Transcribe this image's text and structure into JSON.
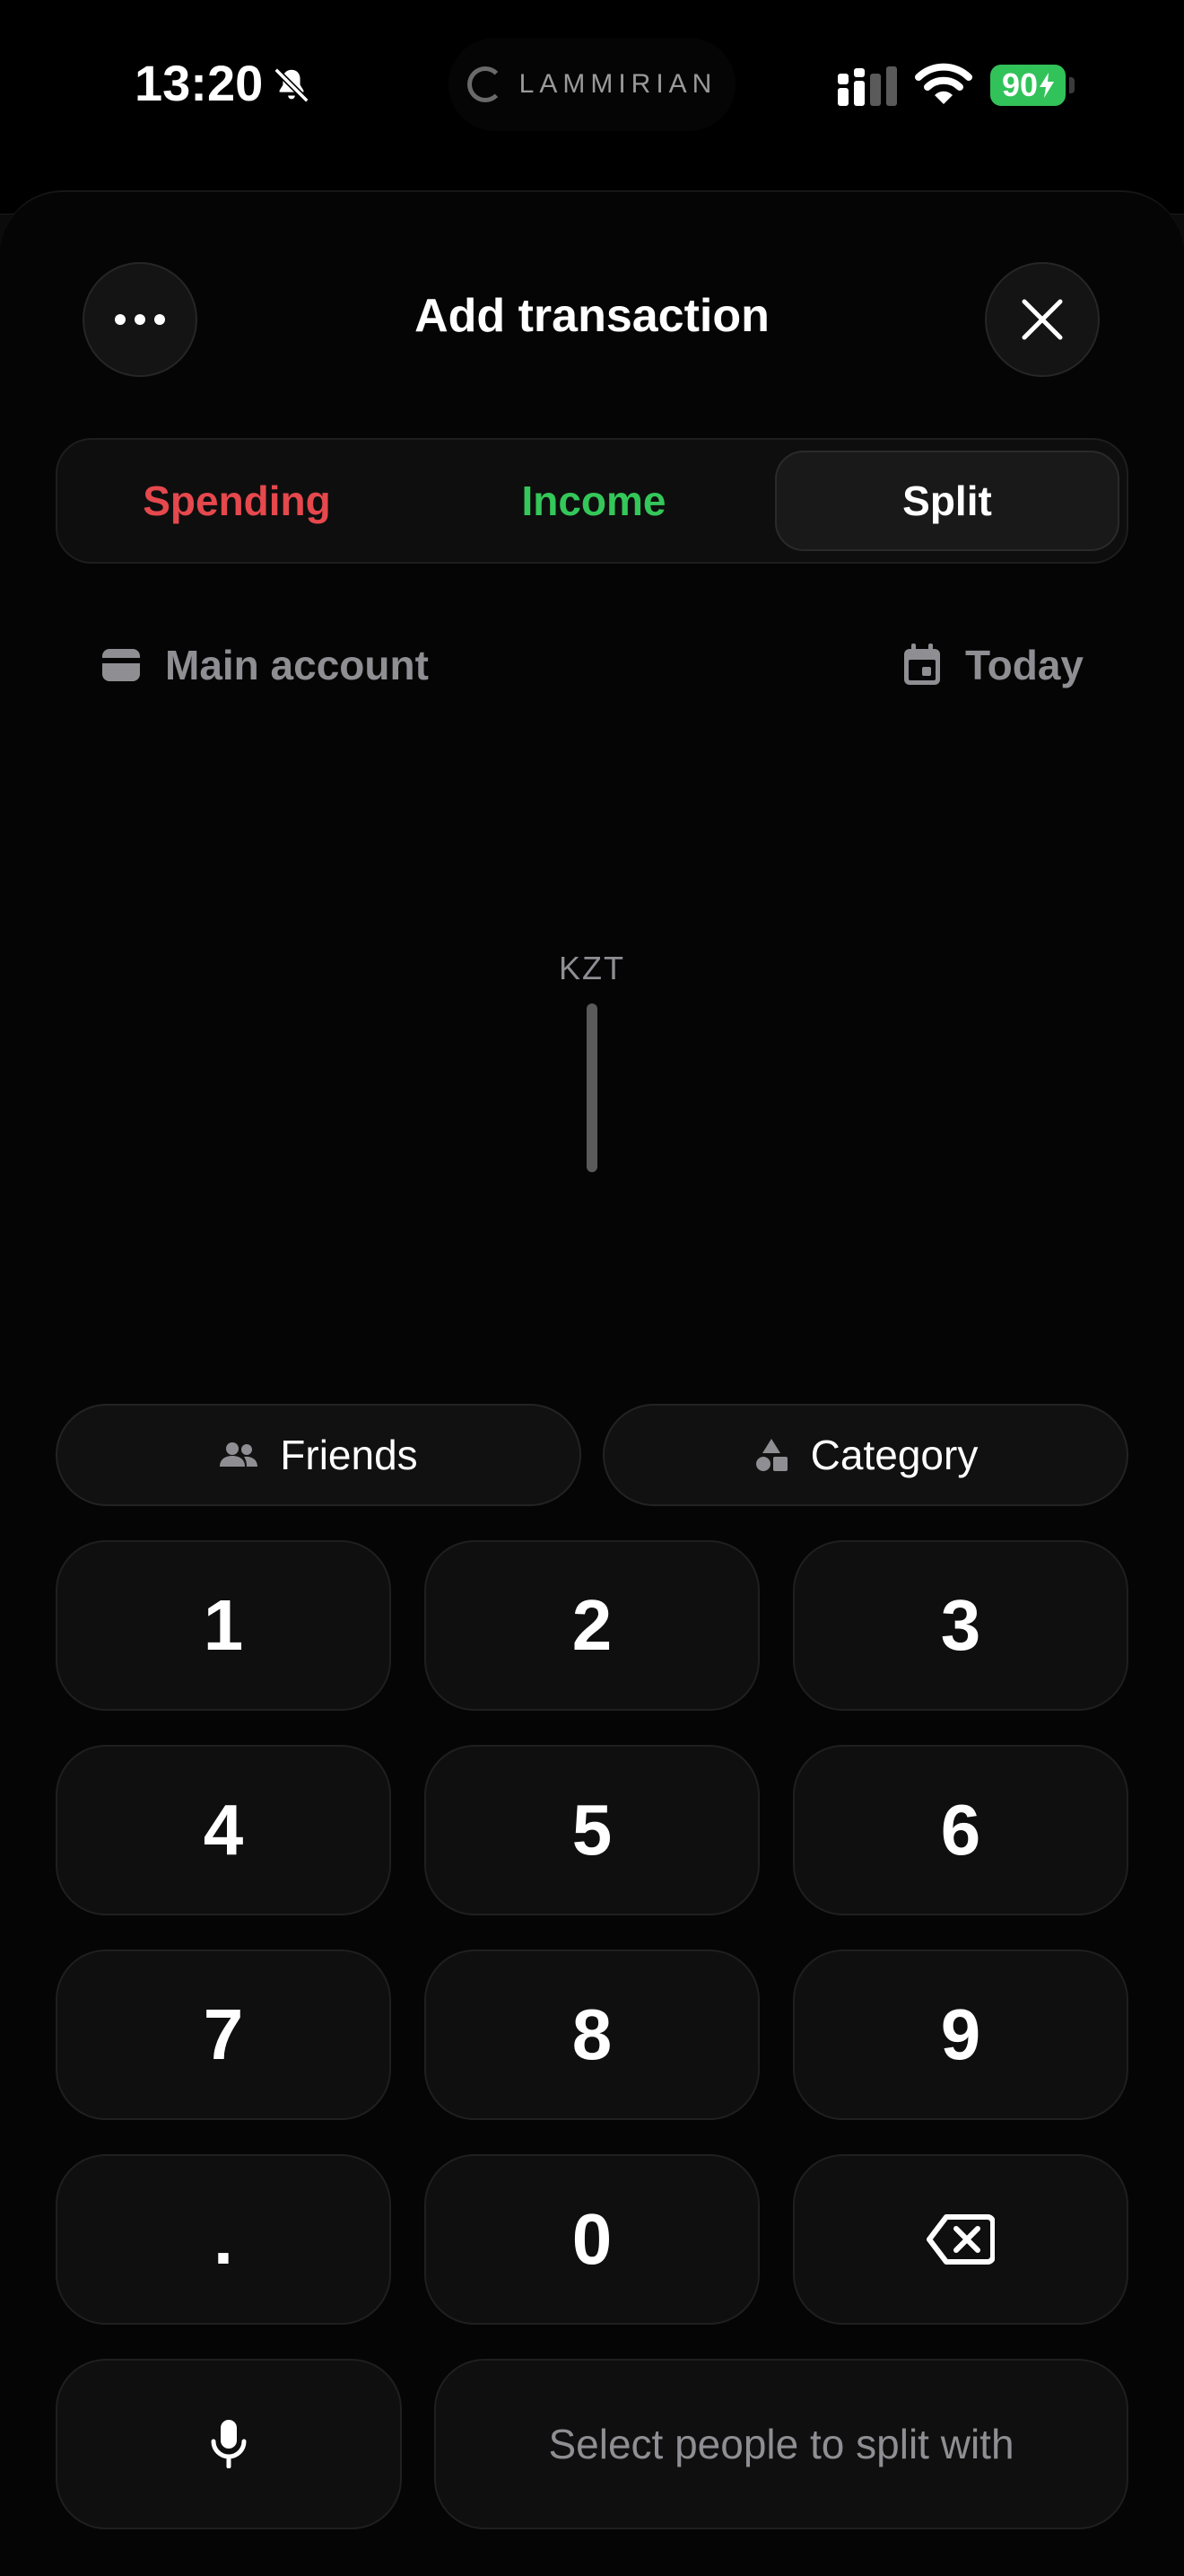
{
  "status_bar": {
    "time": "13:20",
    "island_label": "LAMMIRIAN",
    "battery": "90"
  },
  "header": {
    "title": "Add transaction"
  },
  "segments": {
    "spending": "Spending",
    "income": "Income",
    "split": "Split",
    "selected": "split"
  },
  "meta": {
    "account": "Main account",
    "date": "Today"
  },
  "amount": {
    "currency": "KZT",
    "value": ""
  },
  "chips": {
    "friends": "Friends",
    "category": "Category"
  },
  "keypad": {
    "keys": [
      "1",
      "2",
      "3",
      "4",
      "5",
      "6",
      "7",
      "8",
      "9",
      ".",
      "0"
    ]
  },
  "footer": {
    "split_cta": "Select people to split with"
  },
  "colors": {
    "spending": "#e5484d",
    "income": "#34c759",
    "battery": "#32c25a"
  }
}
